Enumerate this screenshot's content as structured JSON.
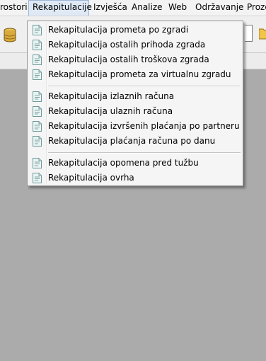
{
  "menubar": {
    "items": [
      {
        "label": "rostori"
      },
      {
        "label": "Rekapitulacije"
      },
      {
        "label": "Izvješća"
      },
      {
        "label": "Analize"
      },
      {
        "label": "Web"
      },
      {
        "label": "Održavanje"
      },
      {
        "label": "Prozo"
      }
    ]
  },
  "toolbar": {
    "left_icon": "database-icon",
    "right_icon": "folder-icon"
  },
  "dropdown": {
    "groups": [
      {
        "items": [
          {
            "label": "Rekapitulacija prometa po zgradi",
            "icon": "document-icon"
          },
          {
            "label": "Rekapitulacija ostalih prihoda zgrada",
            "icon": "document-icon"
          },
          {
            "label": "Rekapitulacija ostalih troškova zgrada",
            "icon": "document-icon"
          },
          {
            "label": "Rekapitulacija prometa za virtualnu zgradu",
            "icon": "document-icon"
          }
        ]
      },
      {
        "items": [
          {
            "label": "Rekapitulacija izlaznih računa",
            "icon": "document-icon"
          },
          {
            "label": "Rekapitulacija ulaznih računa",
            "icon": "document-icon"
          },
          {
            "label": "Rekapitulacija izvršenih plaćanja po partneru",
            "icon": "document-icon"
          },
          {
            "label": "Rekapitulacija plaćanja računa po danu",
            "icon": "document-icon"
          }
        ]
      },
      {
        "items": [
          {
            "label": "Rekapitulacija opomena pred tužbu",
            "icon": "document-icon"
          },
          {
            "label": "Rekapitulacija ovrha",
            "icon": "document-icon"
          }
        ]
      }
    ]
  },
  "colors": {
    "workspace": "#ababab",
    "menu_background": "#f5f5f5",
    "menubar_active": "#dfe9f5"
  }
}
